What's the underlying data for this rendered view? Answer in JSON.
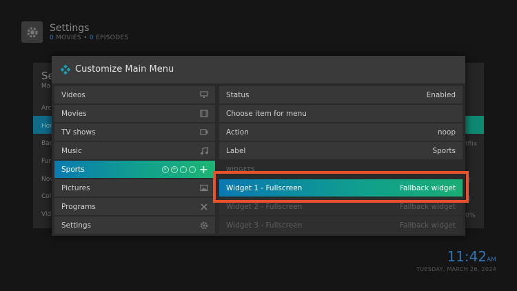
{
  "background": {
    "title": "Settings",
    "subtitle": {
      "movies_count": "0",
      "movies_label": "MOVIES",
      "sep": "•",
      "episodes_count": "0",
      "episodes_label": "EPISODES"
    },
    "left_fragments": [
      "Se",
      "Ma",
      "Arc",
      "Hor",
      "Bac",
      "Fur",
      "Nov",
      "Col",
      "Vid"
    ],
    "right_fragments": [
      "tflix",
      "◻",
      "◻",
      "0%"
    ],
    "clock": {
      "time": "11:42",
      "ampm": "AM",
      "date": "TUESDAY, MARCH 26, 2024"
    }
  },
  "dialog": {
    "title": "Customize Main Menu",
    "menu_items": [
      {
        "label": "Videos",
        "icon": "monitor-icon"
      },
      {
        "label": "Movies",
        "icon": "film-icon"
      },
      {
        "label": "TV shows",
        "icon": "tv-icon"
      },
      {
        "label": "Music",
        "icon": "music-note-icon"
      },
      {
        "label": "Sports",
        "icon": "",
        "selected": true
      },
      {
        "label": "Pictures",
        "icon": "picture-icon"
      },
      {
        "label": "Programs",
        "icon": "tools-icon"
      },
      {
        "label": "Settings",
        "icon": "gear-icon"
      }
    ],
    "properties": {
      "status_label": "Status",
      "status_value": "Enabled",
      "choose_label": "Choose item for menu",
      "action_label": "Action",
      "action_value": "noop",
      "label_label": "Label",
      "label_value": "Sports"
    },
    "widgets_section": "WIDGETS",
    "widgets": [
      {
        "label": "Widget 1 - Fullscreen",
        "value": "Fallback widget"
      },
      {
        "label": "Widget 2 - Fullscreen",
        "value": "Fallback widget"
      },
      {
        "label": "Widget 3 - Fullscreen",
        "value": "Fallback widget"
      }
    ]
  },
  "colors": {
    "accent_blue": "#0b7bb0",
    "accent_green": "#1db575",
    "highlight_box": "#e8512a"
  }
}
